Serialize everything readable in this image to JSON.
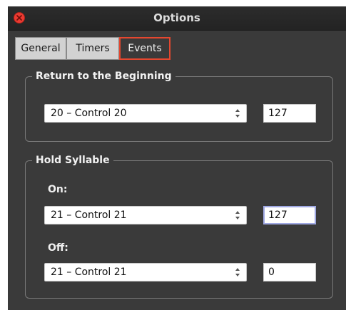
{
  "window": {
    "title": "Options"
  },
  "tabs": [
    {
      "label": "General",
      "active": false
    },
    {
      "label": "Timers",
      "active": false
    },
    {
      "label": "Events",
      "active": true
    }
  ],
  "return_group": {
    "title": "Return to the Beginning",
    "control": "20 – Control 20",
    "value": "127"
  },
  "hold_group": {
    "title": "Hold Syllable",
    "on_label": "On:",
    "on_control": "21 – Control 21",
    "on_value": "127",
    "off_label": "Off:",
    "off_control": "21 – Control 21",
    "off_value": "0"
  },
  "colors": {
    "accent": "#e5472f",
    "focus": "#9fa8e3",
    "background": "#3a3a3a"
  }
}
